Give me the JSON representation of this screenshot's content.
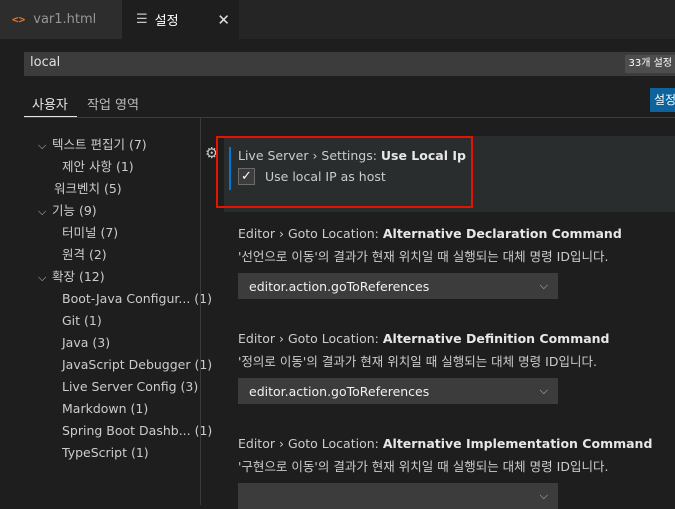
{
  "tabs": [
    {
      "label": "var1.html",
      "icon": "html-code-icon",
      "icon_glyph": "<>"
    },
    {
      "label": "설정",
      "icon": "settings-list-icon",
      "icon_glyph": "☰",
      "close": "✕"
    }
  ],
  "search": {
    "value": "local",
    "count": "33개 설정"
  },
  "scope": {
    "user": "사용자",
    "workspace": "작업 영역",
    "open_json": "설정"
  },
  "toc": [
    {
      "label": "텍스트 편집기 (7)",
      "chev": "⌵"
    },
    {
      "label": "제안 사항 (1)"
    },
    {
      "label": "워크벤치 (5)"
    },
    {
      "label": "기능 (9)",
      "chev": "⌵"
    },
    {
      "label": "터미널 (7)"
    },
    {
      "label": "원격 (2)"
    },
    {
      "label": "확장 (12)",
      "chev": "⌵"
    },
    {
      "label": "Boot-Java Configur... (1)"
    },
    {
      "label": "Git (1)"
    },
    {
      "label": "Java (3)"
    },
    {
      "label": "JavaScript Debugger (1)"
    },
    {
      "label": "Live Server Config (3)"
    },
    {
      "label": "Markdown (1)"
    },
    {
      "label": "Spring Boot Dashb... (1)"
    },
    {
      "label": "TypeScript (1)"
    }
  ],
  "settings": [
    {
      "prefix": "Live Server › Settings: ",
      "name": "Use Local Ip",
      "checkbox_label": "Use local IP as host",
      "checked": true,
      "check_glyph": "✓"
    },
    {
      "prefix": "Editor › Goto Location: ",
      "name": "Alternative Declaration Command",
      "desc": "'선언으로 이동'의 결과가 현재 위치일 때 실행되는 대체 명령 ID입니다.",
      "value": "editor.action.goToReferences"
    },
    {
      "prefix": "Editor › Goto Location: ",
      "name": "Alternative Definition Command",
      "desc": "'정의로 이동'의 결과가 현재 위치일 때 실행되는 대체 명령 ID입니다.",
      "value": "editor.action.goToReferences"
    },
    {
      "prefix": "Editor › Goto Location: ",
      "name": "Alternative Implementation Command",
      "desc": "'구현으로 이동'의 결과가 현재 위치일 때 실행되는 대체 명령 ID입니다.",
      "value": ""
    }
  ],
  "glyphs": {
    "gear": "⚙",
    "chevron_down": "⌵"
  },
  "colors": {
    "accent": "#0078d4",
    "highlight_box": "#e51400",
    "button": "#0e639c"
  }
}
